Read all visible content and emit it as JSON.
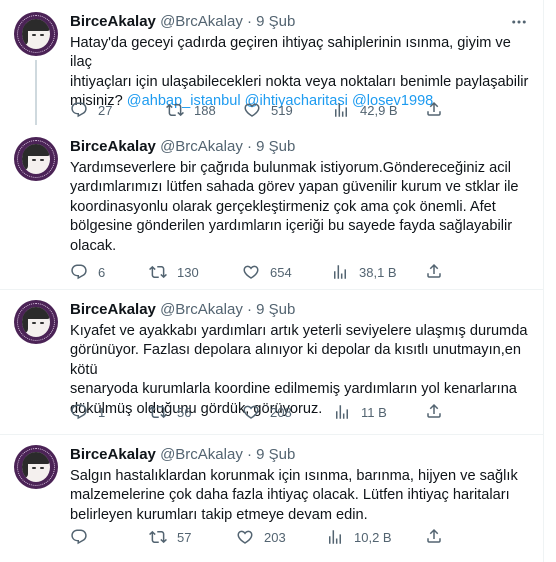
{
  "tweets": [
    {
      "name": "BirceAkalay",
      "handle": "@BrcAkalay",
      "dot": "·",
      "time": "9 Şub",
      "text_lines": [
        "Hatay'da geceyi çadırda geçiren ihtiyaç sahiplerinin ısınma, giyim ve ilaç",
        "ihtiyaçları için ulaşabilecekleri nokta veya noktaları benimle paylaşabilir"
      ],
      "text_tail": "misiniz? ",
      "mentions": [
        "@ahbap_istanbul",
        "@ihtiyacharitasi",
        "@losev1998"
      ],
      "replies": "27",
      "retweets": "188",
      "likes": "519",
      "views": "42,9 B"
    },
    {
      "name": "BirceAkalay",
      "handle": "@BrcAkalay",
      "dot": "·",
      "time": "9 Şub",
      "text_lines": [
        "Yardımseverlere bir çağrıda bulunmak istiyorum.Göndereceğiniz acil",
        "yardımlarımızı lütfen sahada görev yapan güvenilir kurum ve stklar ile",
        "koordinasyonlu olarak gerçekleştirmeniz çok ama çok önemli. Afet",
        "bölgesine gönderilen yardımların içeriği bu sayede fayda sağlayabilir",
        "olacak."
      ],
      "replies": "6",
      "retweets": "130",
      "likes": "654",
      "views": "38,1 B"
    },
    {
      "name": "BirceAkalay",
      "handle": "@BrcAkalay",
      "dot": "·",
      "time": "9 Şub",
      "text_lines": [
        "Kıyafet ve ayakkabı yardımları artık yeterli seviyelere ulaşmış durumda",
        "görünüyor. Fazlası depolara alınıyor ki depolar da kısıtlı unutmayın,en kötü",
        "senaryoda kurumlarla koordine edilmemiş yardımların yol kenarlarına",
        "dökülmüş olduğunu gördük, görüyoruz."
      ],
      "replies": "1",
      "retweets": "56",
      "likes": "208",
      "views": "11 B"
    },
    {
      "name": "BirceAkalay",
      "handle": "@BrcAkalay",
      "dot": "·",
      "time": "9 Şub",
      "text_lines": [
        "Salgın hastalıklardan korunmak için ısınma, barınma, hijyen ve sağlık",
        "malzemelerine çok daha fazla ihtiyaç olacak. Lütfen ihtiyaç haritaları",
        "belirleyen kurumları takip etmeye devam edin."
      ],
      "replies": "",
      "retweets": "57",
      "likes": "203",
      "views": "10,2 B"
    }
  ],
  "icons": {
    "more": "more-horizontal-icon",
    "reply": "reply-bubble-icon",
    "retweet": "retweet-icon",
    "like": "heart-icon",
    "views": "bar-chart-icon",
    "share": "share-upload-icon"
  },
  "colors": {
    "link": "#1d9bf0",
    "secondary_text": "#536471",
    "avatar_bg": "#4b2356",
    "thread_line": "#cfd9de"
  }
}
